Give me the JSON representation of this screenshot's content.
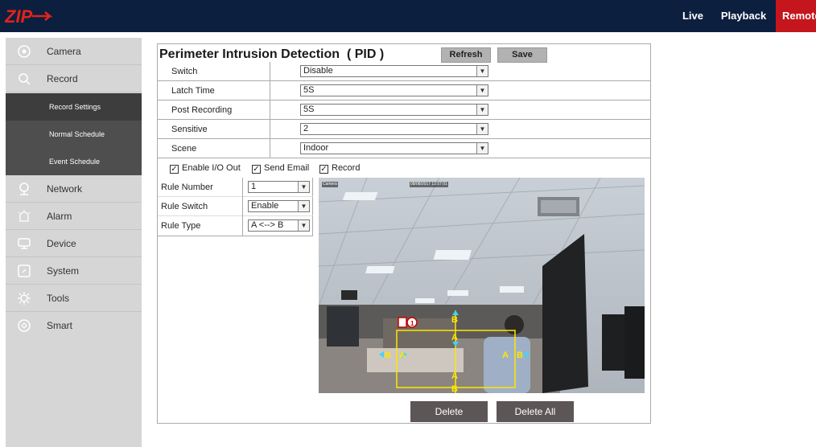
{
  "topbar": {
    "logo_text": "ZIP",
    "nav": [
      {
        "label": "Live"
      },
      {
        "label": "Playback"
      },
      {
        "label": "Remote"
      }
    ],
    "colors": {
      "bar": "#0d1f3f",
      "active": "#c4161c"
    }
  },
  "sidebar": {
    "items": [
      {
        "label": "Camera",
        "icon": "camera-icon"
      },
      {
        "label": "Record",
        "icon": "search-icon"
      },
      {
        "label": "Network",
        "icon": "network-icon"
      },
      {
        "label": "Alarm",
        "icon": "alarm-icon"
      },
      {
        "label": "Device",
        "icon": "device-icon"
      },
      {
        "label": "System",
        "icon": "system-icon"
      },
      {
        "label": "Tools",
        "icon": "tools-icon"
      },
      {
        "label": "Smart",
        "icon": "smart-icon"
      }
    ],
    "record_sub": [
      {
        "label": "Record Settings"
      },
      {
        "label": "Normal Schedule"
      },
      {
        "label": "Event Schedule"
      }
    ]
  },
  "panel": {
    "title": "Perimeter Intrusion Detection  ( PID )",
    "refresh_label": "Refresh",
    "save_label": "Save",
    "fields": [
      {
        "label": "Switch",
        "value": "Disable"
      },
      {
        "label": "Latch Time",
        "value": "5S"
      },
      {
        "label": "Post Recording",
        "value": "5S"
      },
      {
        "label": "Sensitive",
        "value": "2"
      },
      {
        "label": "Scene",
        "value": "Indoor"
      }
    ],
    "checks": [
      {
        "label": "Enable I/O Out",
        "checked": true
      },
      {
        "label": "Send Email",
        "checked": true
      },
      {
        "label": "Record",
        "checked": true
      }
    ],
    "rules": [
      {
        "label": "Rule Number",
        "value": "1"
      },
      {
        "label": "Rule Switch",
        "value": "Enable"
      },
      {
        "label": "Rule Type",
        "value": "A <--> B"
      }
    ],
    "camera": {
      "channel_label": "Camera",
      "timestamp": "08/08/2017 12:57:01",
      "rule_marker": "1",
      "line_labels": [
        "A",
        "B"
      ]
    },
    "delete_label": "Delete",
    "delete_all_label": "Delete All"
  }
}
